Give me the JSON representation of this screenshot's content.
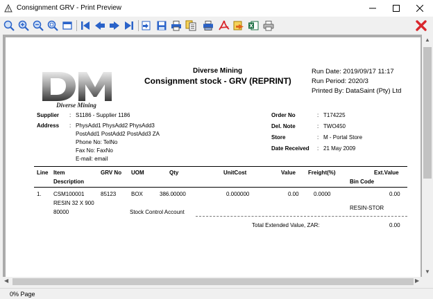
{
  "window": {
    "title": "Consignment GRV - Print Preview"
  },
  "toolbar": {
    "buttons": [
      {
        "name": "zoom-icon"
      },
      {
        "name": "zoom-in-icon"
      },
      {
        "name": "zoom-out-icon"
      },
      {
        "name": "zoom-page-icon"
      },
      {
        "name": "window-icon"
      },
      {
        "name": "first-page-icon"
      },
      {
        "name": "prev-page-icon"
      },
      {
        "name": "next-page-icon"
      },
      {
        "name": "last-page-icon"
      },
      {
        "name": "goto-page-icon"
      },
      {
        "name": "save-icon"
      },
      {
        "name": "print-icon"
      },
      {
        "name": "copy-icon"
      },
      {
        "name": "print-setup-icon"
      },
      {
        "name": "pdf-icon"
      },
      {
        "name": "export-icon"
      },
      {
        "name": "excel-icon"
      },
      {
        "name": "printer-icon"
      }
    ]
  },
  "report": {
    "logo_text": "Diverse Mining",
    "company": "Diverse Mining",
    "title": "Consignment stock - GRV (REPRINT)",
    "run_date": "Run Date:  2019/09/17 11:17",
    "run_period": "Run Period: 2020/3",
    "printed_by": "Printed By: DataSaint (Pty) Ltd",
    "supplier_label": "Supplier",
    "supplier_value": "S1186 - Supplier 1186",
    "address_label": "Address",
    "address_lines": [
      "PhysAdd1 PhysAdd2 PhysAdd3",
      "PostAdd1 PostAdd2 PostAdd3 ZA",
      "Phone No: TelNo",
      "Fax No:   FaxNo",
      "E-mail:   email"
    ],
    "order_no_label": "Order No",
    "order_no_value": "T174225",
    "del_note_label": "Del. Note",
    "del_note_value": "TWO450",
    "store_label": "Store",
    "store_value": "M - Portal Store",
    "date_received_label": "Date Received",
    "date_received_value": "21 May 2009",
    "colon": ":",
    "headers": {
      "line": "Line",
      "item": "Item",
      "description": "Description",
      "grv_no": "GRV No",
      "uom": "UOM",
      "qty": "Qty",
      "unit_cost": "UnitCost",
      "value": "Value",
      "freight": "Freight(%)",
      "ext_value": "Ext.Value",
      "bin_code": "Bin Code"
    },
    "row": {
      "line": "1.",
      "item": "CSM100001",
      "grv_no": "85123",
      "uom": "BOX",
      "qty": "386.00000",
      "unit_cost": "0.000000",
      "value": "0.00",
      "freight": "0.0000",
      "ext_value": "0.00",
      "description": "RESIN  32 X 900",
      "bin_code": "RESIN-STOR",
      "account_code": "80000",
      "account_name": "Stock Control Account"
    },
    "total_label": "Total Extended Value, ZAR:",
    "total_value": "0.00"
  },
  "status": {
    "zoom": "0%",
    "page_label": "Page"
  },
  "colors": {
    "toolbar_icon_blue": "#2a63c9",
    "close_red": "#d9262c",
    "preview_bg": "#ababab"
  }
}
